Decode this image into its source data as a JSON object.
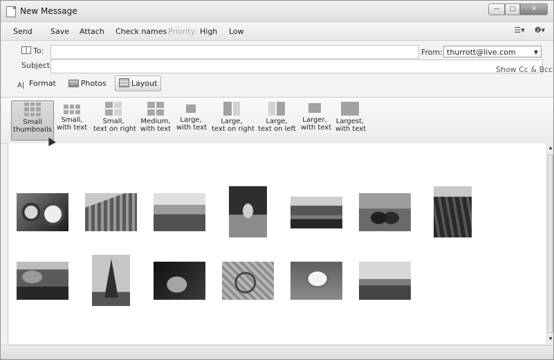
{
  "window": {
    "title": "New Message",
    "buttons": {
      "minimize": "—",
      "maximize": "□",
      "close": "✕"
    }
  },
  "toolbar": {
    "send": "Send",
    "save": "Save",
    "attach": "Attach",
    "check_names": "Check names",
    "priority_label": "Priority:",
    "priority_high": "High",
    "priority_low": "Low",
    "right_icons": [
      "menu-icon",
      "help-icon"
    ],
    "right_icon_glyphs": [
      "☰▾",
      "❷▾"
    ]
  },
  "compose": {
    "to_label": "To:",
    "to_value": "",
    "subject_label": "Subject:",
    "subject_value": "",
    "from_label": "From:",
    "from_value": "thurrott@live.com",
    "show_cc_bcc": "Show Cc & Bcc"
  },
  "tabs": [
    {
      "label": "Format",
      "icon": "format-icon",
      "active": false
    },
    {
      "label": "Photos",
      "icon": "photos-icon",
      "active": false
    },
    {
      "label": "Layout",
      "icon": "layout-icon",
      "active": true
    }
  ],
  "layouts": [
    {
      "line1": "Small",
      "line2": "thumbnails",
      "selected": true
    },
    {
      "line1": "Small,",
      "line2": "with text",
      "selected": false
    },
    {
      "line1": "Small,",
      "line2": "text on right",
      "selected": false
    },
    {
      "line1": "Medium,",
      "line2": "with text",
      "selected": false
    },
    {
      "line1": "Large,",
      "line2": "with text",
      "selected": false
    },
    {
      "line1": "Large,",
      "line2": "text on right",
      "selected": false
    },
    {
      "line1": "Large,",
      "line2": "text on left",
      "selected": false
    },
    {
      "line1": "Larger,",
      "line2": "with text",
      "selected": false
    },
    {
      "line1": "Largest,",
      "line2": "with text",
      "selected": false
    }
  ],
  "photos": [
    "cafe-photo",
    "street-photo",
    "city-view-photo",
    "statue-photo",
    "river-photo",
    "couple-photo",
    "park-photo",
    "fountain-photo",
    "eiffel-tower-photo",
    "dark-photo",
    "ferris-wheel-photo",
    "coffee-cup-photo",
    "riverbank-photo"
  ]
}
